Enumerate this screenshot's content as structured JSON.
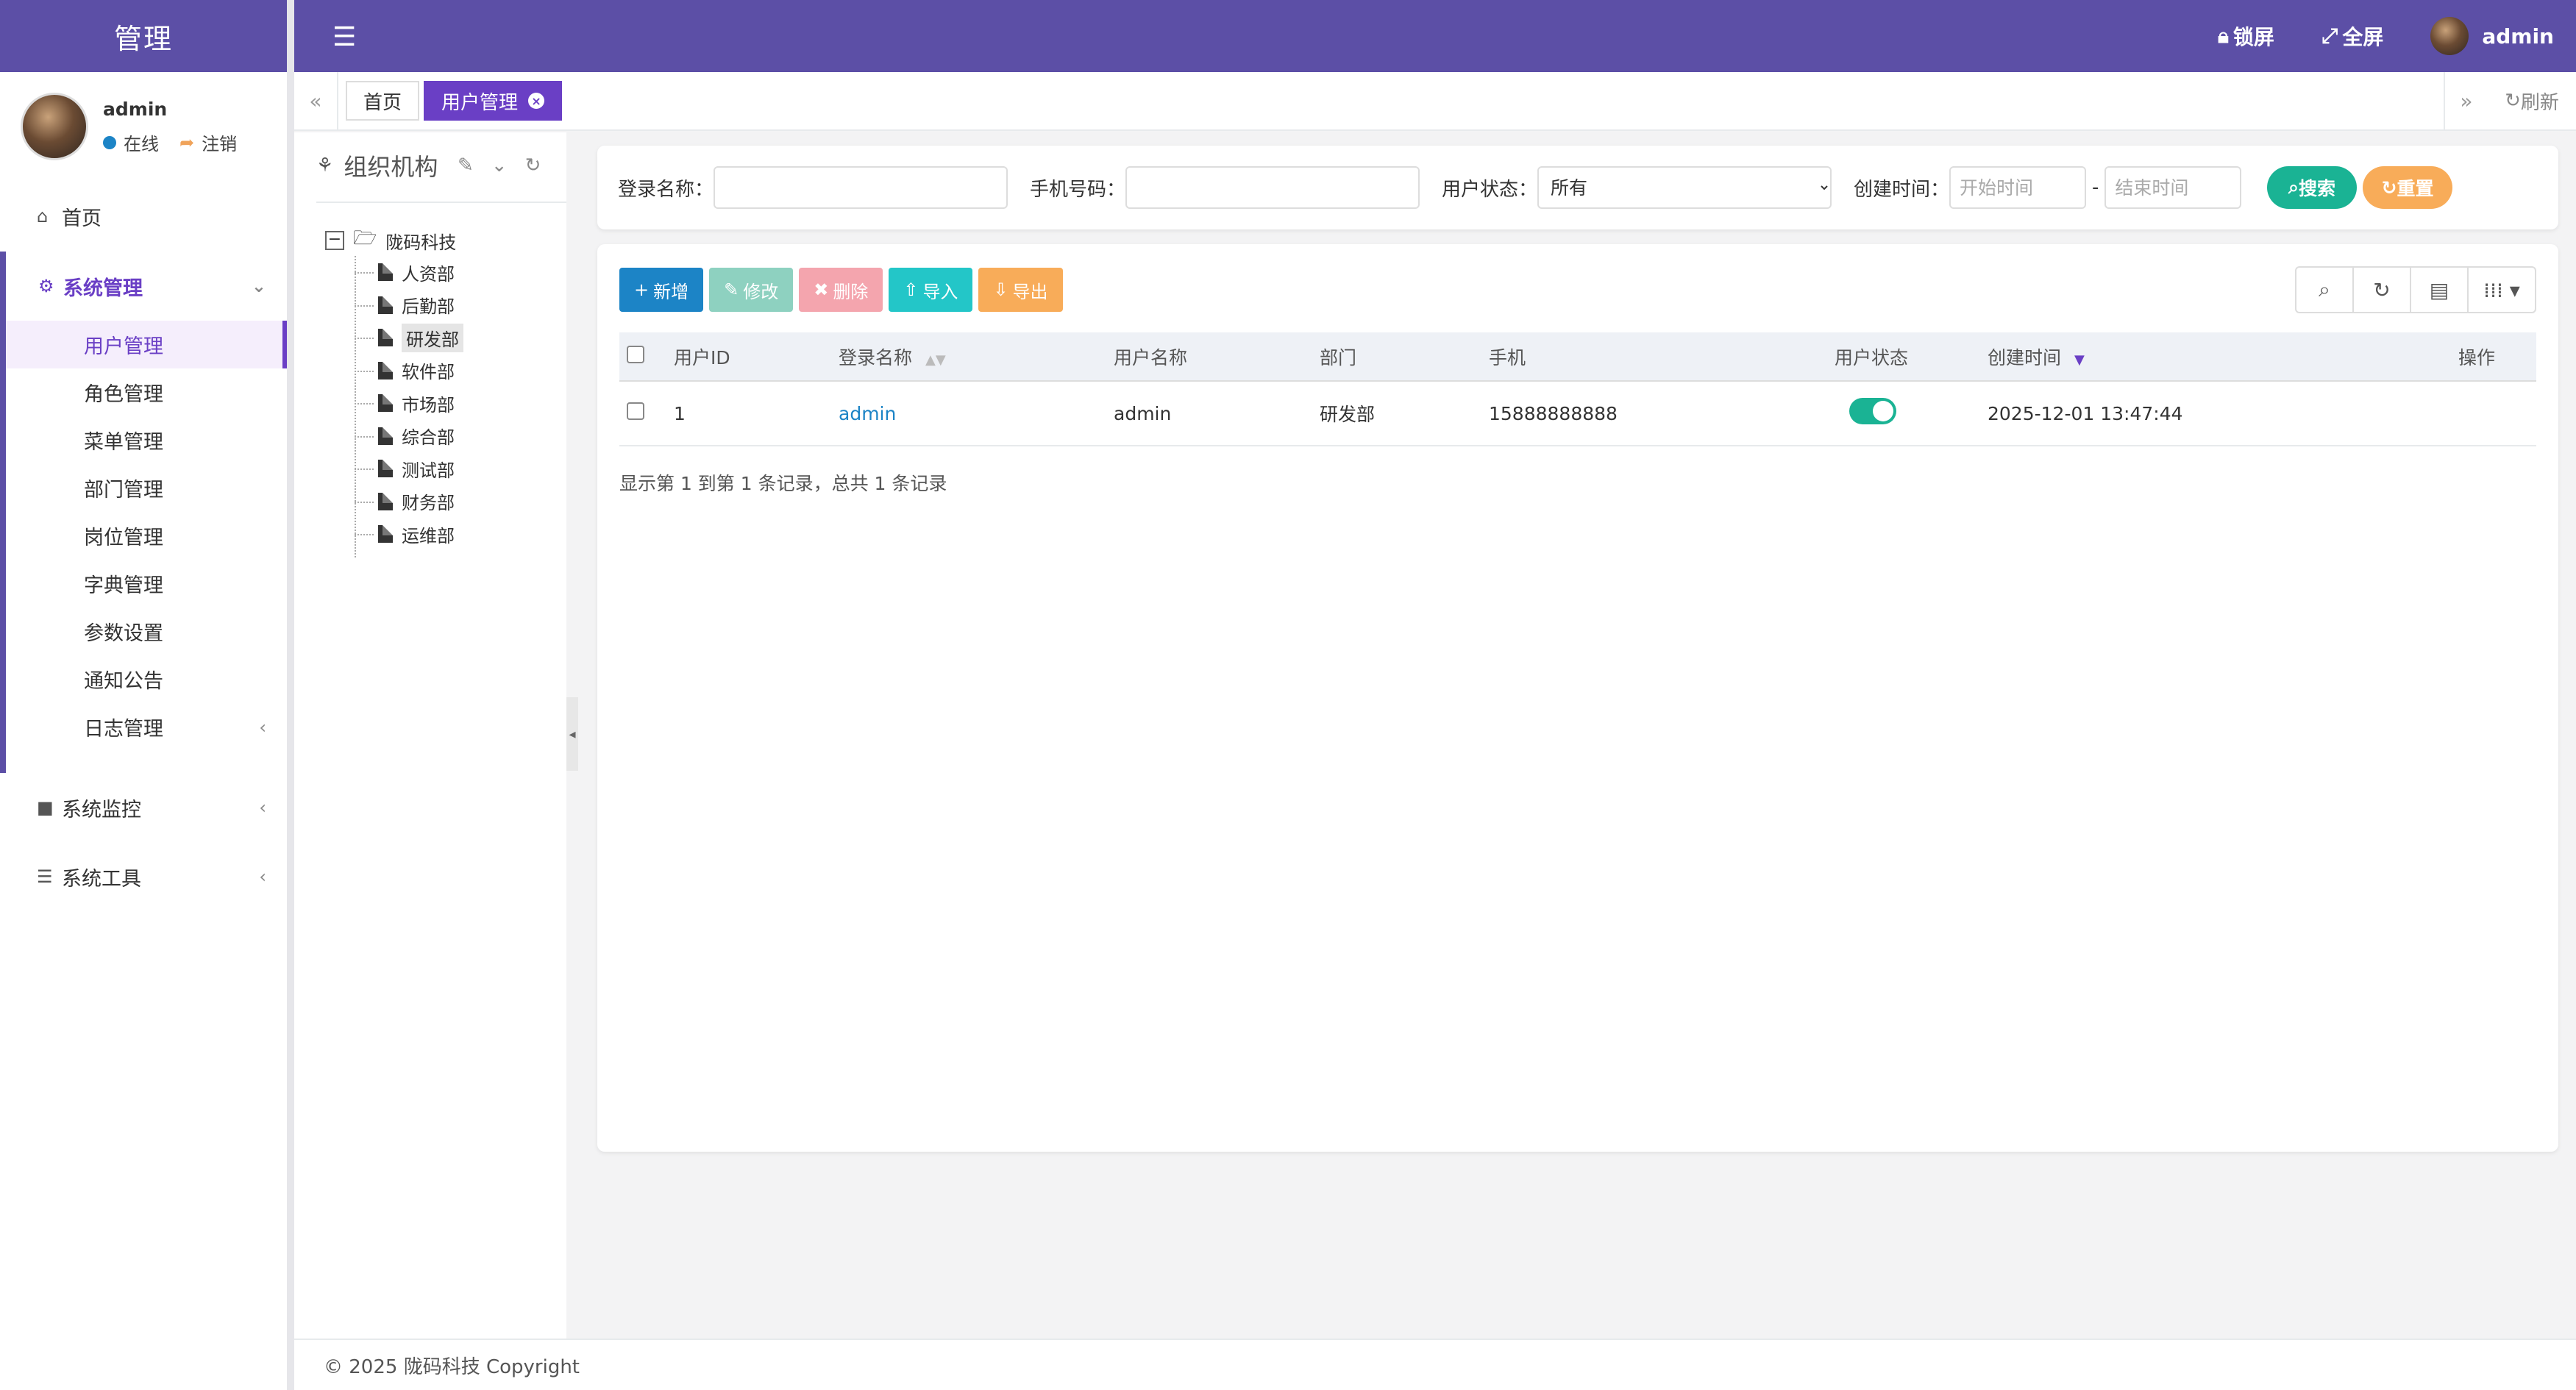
{
  "sidebar": {
    "brand": "管理",
    "user": {
      "name": "admin",
      "status": "在线",
      "logout": "注销"
    },
    "home": "首页",
    "system_mgmt": {
      "label": "系统管理",
      "items": [
        "用户管理",
        "角色管理",
        "菜单管理",
        "部门管理",
        "岗位管理",
        "字典管理",
        "参数设置",
        "通知公告",
        "日志管理"
      ]
    },
    "monitor": "系统监控",
    "tools": "系统工具"
  },
  "topbar": {
    "lock": "锁屏",
    "fullscreen": "全屏",
    "user": "admin"
  },
  "tabs": {
    "home": "首页",
    "active": "用户管理",
    "refresh": "刷新"
  },
  "org": {
    "title": "组织机构",
    "root": "陇码科技",
    "departments": [
      "人资部",
      "后勤部",
      "研发部",
      "软件部",
      "市场部",
      "综合部",
      "测试部",
      "财务部",
      "运维部"
    ],
    "selected": "研发部"
  },
  "search": {
    "login_name_label": "登录名称：",
    "phone_label": "手机号码：",
    "status_label": "用户状态：",
    "status_value": "所有",
    "created_label": "创建时间：",
    "start_placeholder": "开始时间",
    "end_placeholder": "结束时间",
    "range_sep": "-",
    "search_btn": "搜索",
    "reset_btn": "重置"
  },
  "toolbar": {
    "add": "新增",
    "edit": "修改",
    "delete": "删除",
    "import": "导入",
    "export": "导出"
  },
  "table": {
    "headers": {
      "id": "用户ID",
      "login": "登录名称",
      "username": "用户名称",
      "dept": "部门",
      "phone": "手机",
      "status": "用户状态",
      "created": "创建时间",
      "ops": "操作"
    },
    "rows": [
      {
        "id": "1",
        "login": "admin",
        "username": "admin",
        "dept": "研发部",
        "phone": "15888888888",
        "status_on": true,
        "created": "2025-12-01 13:47:44"
      }
    ],
    "pager": "显示第 1 到第 1 条记录，总共 1 条记录"
  },
  "footer": "© 2025 陇码科技 Copyright",
  "colors": {
    "brand": "#5c4fa6",
    "active": "#6a3fc5",
    "primary": "#1c84c6",
    "success": "#1ab394",
    "warning": "#f8ac59",
    "danger": "#ed5565",
    "info": "#23c6c8"
  }
}
